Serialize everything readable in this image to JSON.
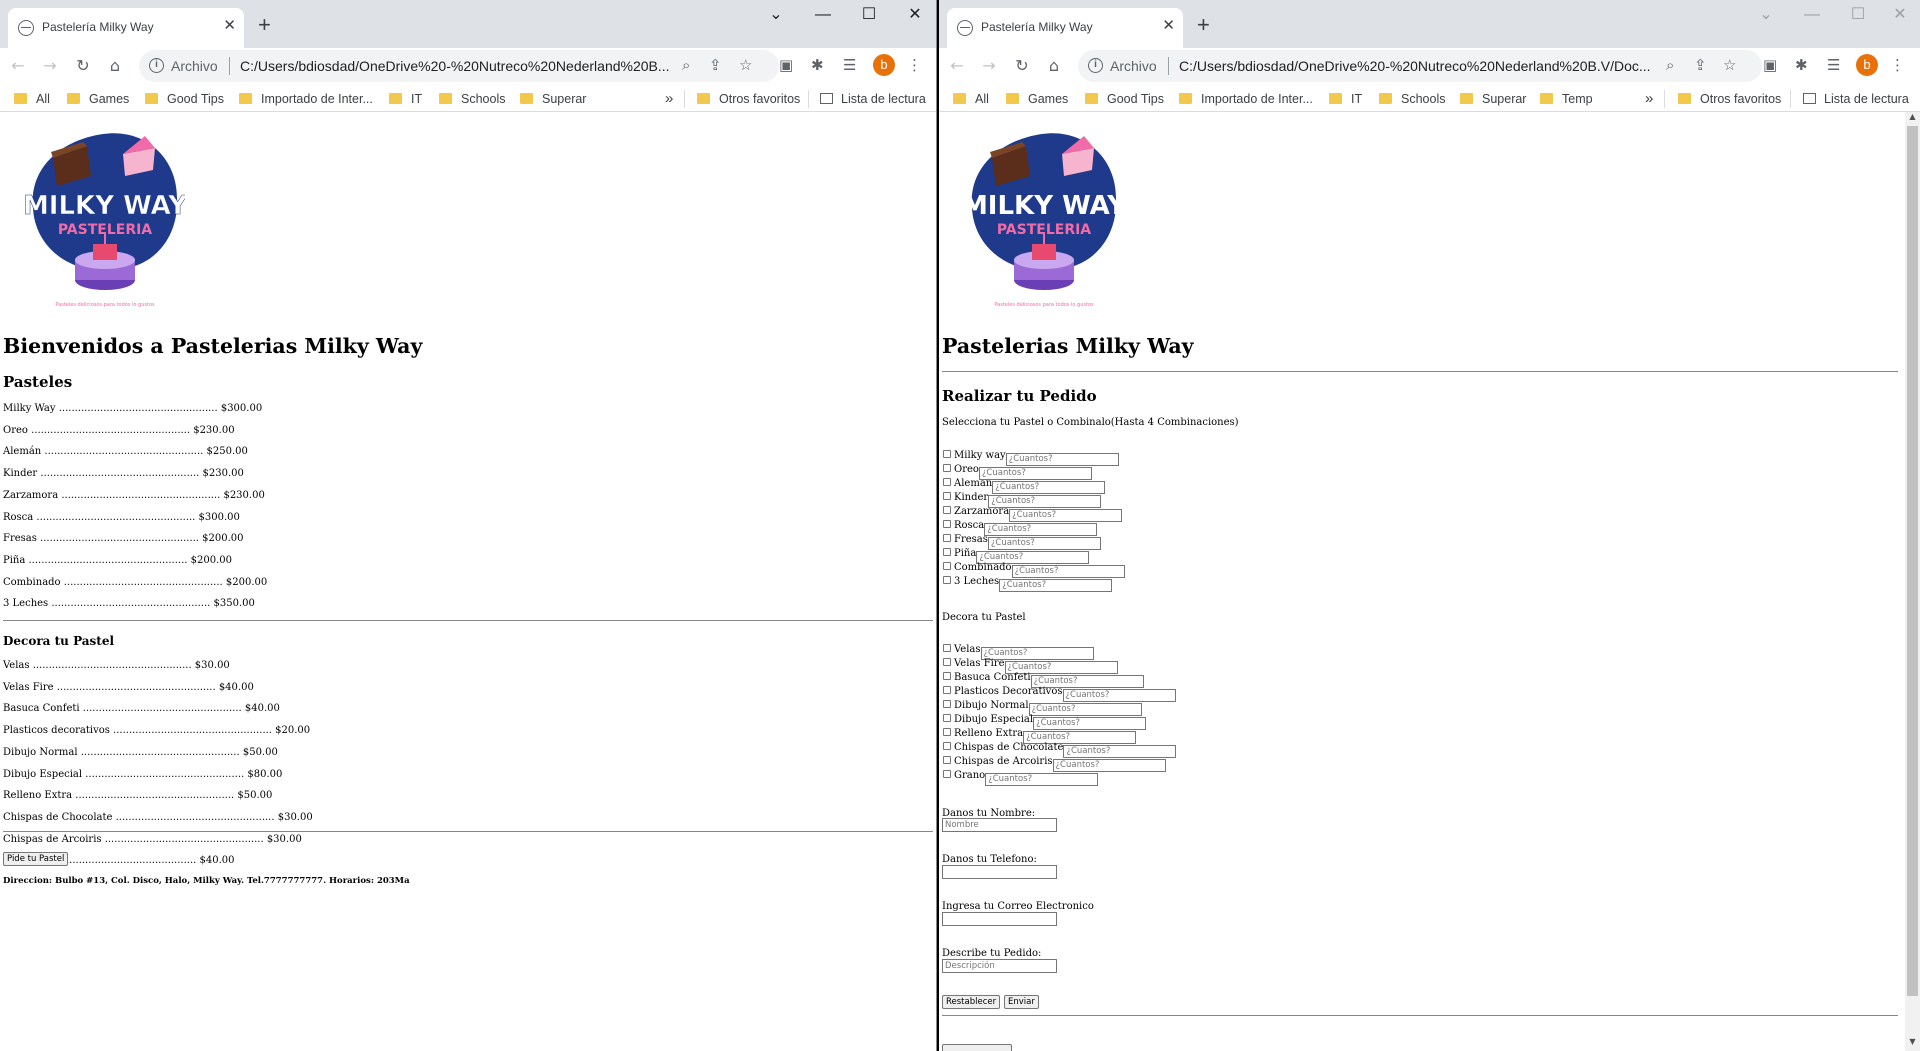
{
  "browser": {
    "tab_title": "Pastelería Milky Way",
    "archivo_label": "Archivo",
    "left_url": "C:/Users/bdiosdad/OneDrive%20-%20Nutreco%20Nederland%20B...",
    "right_url": "C:/Users/bdiosdad/OneDrive%20-%20Nutreco%20Nederland%20B.V/Doc...",
    "avatar_letter": "b",
    "bookmarks_left": [
      "All",
      "Games",
      "Good Tips",
      "Importado de Inter...",
      "IT",
      "Schools",
      "Superar"
    ],
    "bookmarks_right": [
      "All",
      "Games",
      "Good Tips",
      "Importado de Inter...",
      "IT",
      "Schools",
      "Superar",
      "Temp"
    ],
    "more_bookmarks": "»",
    "otros_favoritos": "Otros favoritos",
    "lista_de_lectura": "Lista de lectura"
  },
  "left_page": {
    "logo": {
      "title": "MILKY WAY",
      "subtitle": "PASTELERIA",
      "tagline": "Pasteles deliciosos para todos lo gustos"
    },
    "heading": "Bienvenidos a Pastelerias Milky Way",
    "pasteles_heading": "Pasteles",
    "pasteles": [
      "Milky Way .................................................. $300.00",
      "Oreo .................................................. $230.00",
      "Alemán .................................................. $250.00",
      "Kinder .................................................. $230.00",
      "Zarzamora .................................................. $230.00",
      "Rosca .................................................. $300.00",
      "Fresas .................................................. $200.00",
      "Piña .................................................. $200.00",
      "Combinado .................................................. $200.00",
      "3 Leches .................................................. $350.00"
    ],
    "decora_heading": "Decora tu Pastel",
    "decoraciones": [
      "Velas .................................................. $30.00",
      "Velas Fire .................................................. $40.00",
      "Basuca Confeti .................................................. $40.00",
      "Plasticos decorativos .................................................. $20.00",
      "Dibujo Normal .................................................. $50.00",
      "Dibujo Especial .................................................. $80.00",
      "Relleno Extra .................................................. $50.00",
      "Chispas de Chocolate .................................................. $30.00",
      "Chispas de Arcoiris .................................................. $30.00",
      "Grano .................................................. $40.00"
    ],
    "order_button": "Pide tu Pastel",
    "footer": "Direccion: Bulbo #13, Col. Disco, Halo, Milky Way. Tel.7777777777. Horarios: 203Ma"
  },
  "right_page": {
    "heading": "Pastelerias Milky Way",
    "order_heading": "Realizar tu Pedido",
    "select_text": "Selecciona tu Pastel o Combinalo(Hasta 4 Combinaciones)",
    "qty_placeholder": "¿Cuantos?",
    "pasteles": [
      "Milky way",
      "Oreo",
      "Aleman",
      "Kinder",
      "Zarzamora",
      "Rosca",
      "Fresas",
      "Piña",
      "Combinado",
      "3 Leches"
    ],
    "decora_text": "Decora tu Pastel",
    "decoraciones": [
      "Velas",
      "Velas Fire",
      "Basuca Confeti",
      "Plasticos Decorativos",
      "Dibujo Normal",
      "Dibujo Especial",
      "Relleno Extra",
      "Chispas de Chocolate",
      "Chispas de Arcoiris",
      "Grano"
    ],
    "name_label": "Danos tu Nombre:",
    "name_placeholder": "Nombre",
    "phone_label": "Danos tu Telefono:",
    "email_label": "Ingresa tu Correo Electronico",
    "desc_label": "Describe tu Pedido:",
    "desc_placeholder": "Descripción",
    "reset_button": "Restablecer",
    "submit_button": "Enviar"
  },
  "colors": {
    "logo_blob": "#1f3a8a",
    "logo_pink": "#f06ba8",
    "avatar": "#e8710a",
    "folder": "#f2c94c"
  }
}
